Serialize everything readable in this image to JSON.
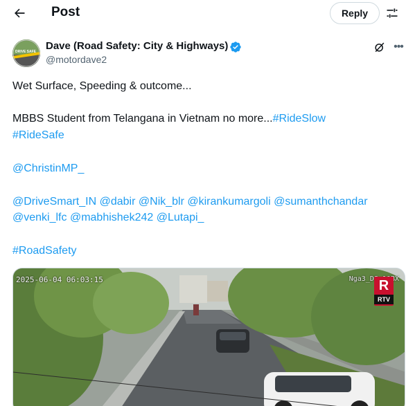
{
  "header": {
    "title": "Post",
    "reply_label": "Reply"
  },
  "author": {
    "name": "Dave (Road Safety: City & Highways)",
    "handle": "@motordave2",
    "avatar_text": "DRIVE SAFE"
  },
  "tweet": {
    "line1": "Wet Surface, Speeding & outcome...",
    "line2_text": "MBBS Student from Telangana in Vietnam no more...",
    "line2_tag": "#RideSlow",
    "line3_tag": "#RideSafe",
    "mention1": "@ChristinMP_",
    "mentions_row1": [
      "@DriveSmart_IN",
      "@dabir",
      "@Nik_blr",
      "@kirankumargoli",
      "@sumanthchandar"
    ],
    "mentions_row2": [
      "@venki_lfc",
      "@mabhishek242",
      "@Lutapi_"
    ],
    "road_tag": "#RoadSafety"
  },
  "media": {
    "timestamp": "2025-06-04 06:03:15",
    "camera_id": "Nga3_DS 10BX",
    "watermark_top": "R",
    "watermark_bottom": "RTV"
  },
  "colors": {
    "link": "#1d9bf0",
    "verified": "#1d9bf0",
    "text": "#0f1419",
    "secondary": "#536471"
  }
}
